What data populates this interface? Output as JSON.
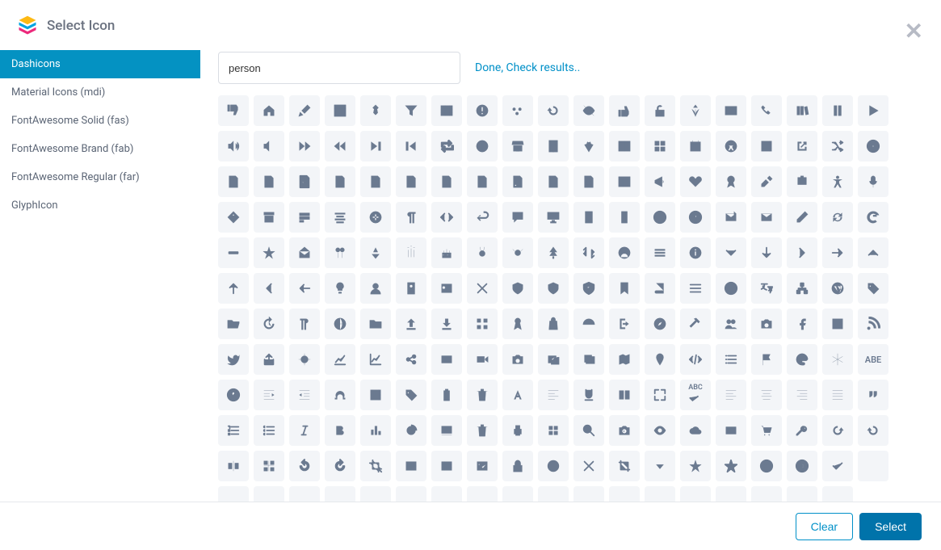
{
  "header": {
    "title": "Select Icon"
  },
  "sidebar": {
    "items": [
      {
        "label": "Dashicons",
        "active": true
      },
      {
        "label": "Material Icons (mdi)",
        "active": false
      },
      {
        "label": "FontAwesome Solid (fas)",
        "active": false
      },
      {
        "label": "FontAwesome Brand (fab)",
        "active": false
      },
      {
        "label": "FontAwesome Regular (far)",
        "active": false
      },
      {
        "label": "GlyphIcon",
        "active": false
      }
    ]
  },
  "search": {
    "value": "person",
    "placeholder": ""
  },
  "status": {
    "text": "Done, Check results.."
  },
  "footer": {
    "clear": "Clear",
    "select": "Select"
  },
  "icons": [
    "thumbs-down",
    "home",
    "brush",
    "layout",
    "pin",
    "filter",
    "table",
    "alert",
    "dots",
    "undo",
    "eye-off",
    "thumbs-up",
    "lock-open",
    "palm",
    "id-card",
    "phone",
    "books",
    "pause",
    "play",
    "volume",
    "volume-mute",
    "forward",
    "rewind",
    "skip-forward",
    "skip-back",
    "repeat",
    "contrast",
    "store",
    "building",
    "carrot",
    "columns",
    "grid",
    "calendar",
    "accessibility",
    "film",
    "external",
    "shuffle",
    "plus-circle",
    "file-zip",
    "file-audio",
    "file-code",
    "file",
    "file-lines",
    "file-text",
    "file-spreadsheet",
    "file-video",
    "file-rss",
    "file-invoice",
    "file-doc",
    "sidebar-layout",
    "megaphone",
    "heart",
    "award",
    "tools",
    "badge",
    "accessibility-alt",
    "mic",
    "tag-alt",
    "archive",
    "rows",
    "align",
    "html",
    "paragraph",
    "code",
    "return",
    "comment",
    "desktop",
    "tablet",
    "mobile",
    "clock",
    "help",
    "mail-out",
    "mail",
    "edit",
    "refresh",
    "google",
    "minus",
    "star-half",
    "envelope-open",
    "balloons",
    "party",
    "candles",
    "cake",
    "bunny",
    "bee",
    "tree",
    "sort",
    "avatar",
    "menu",
    "info",
    "chevron-down",
    "arrow-down",
    "chevron-right",
    "arrow-right",
    "chevron-up",
    "arrow-up",
    "chevron-left",
    "arrow-left",
    "lightbulb",
    "user",
    "id-badge",
    "contact",
    "x",
    "shield",
    "shield-alt",
    "shield-check",
    "bookmark",
    "book",
    "list",
    "smile",
    "translate",
    "sitemap",
    "wordpress",
    "tag",
    "folder-open",
    "history",
    "paragraph-rtl",
    "globe",
    "folder",
    "upload",
    "download",
    "apps",
    "ribbon",
    "bag",
    "dashboard",
    "exit",
    "compass",
    "hammer",
    "users",
    "camera",
    "facebook-f",
    "facebook",
    "rss",
    "twitter",
    "share-out",
    "target",
    "chart-up",
    "chart-line",
    "share",
    "video",
    "video-camera",
    "camera-alt",
    "gallery",
    "images",
    "map",
    "marker",
    "code-alt",
    "list-alt",
    "flag",
    "palette",
    "snowflake",
    "abc",
    "question",
    "indent-right",
    "indent-left",
    "omega",
    "film-strip",
    "tag-sale",
    "clipboard",
    "trash",
    "font-a",
    "align-left",
    "underline",
    "text-columns",
    "fullscreen",
    "spellcheck",
    "align-left-2",
    "align-center",
    "align-right",
    "align-justify",
    "quote",
    "list-ol",
    "list-ul",
    "italic",
    "bold",
    "chart-bar",
    "chart-pie",
    "slideshow",
    "trash-alt",
    "printer-alt",
    "grid-4",
    "search",
    "camera-2",
    "eye",
    "cloud",
    "card",
    "cart",
    "key",
    "redo",
    "undo-alt",
    "mirror",
    "grid-distribute",
    "rotate-left",
    "rotate-right",
    "crop",
    "video-grid",
    "list-details",
    "image",
    "lock",
    "circle",
    "x-alt",
    "crop-alt",
    "caret-down",
    "star-fill",
    "star-outline",
    "x-circle",
    "arrow-circle",
    "check",
    "",
    "",
    "",
    "",
    "",
    "",
    "",
    "",
    "",
    "",
    "",
    "",
    "",
    "",
    "",
    "",
    "",
    "",
    ""
  ]
}
